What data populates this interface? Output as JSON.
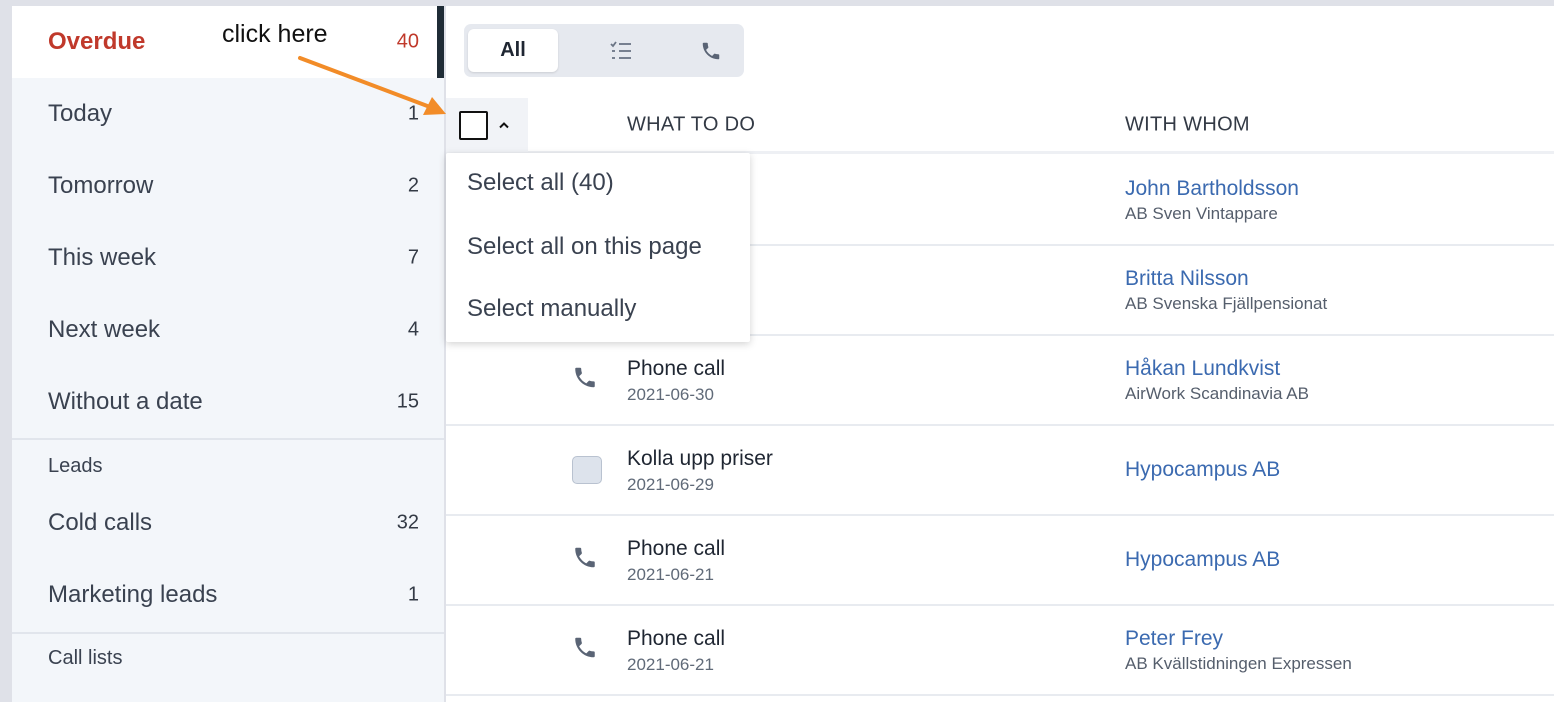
{
  "sidebar": {
    "items": [
      {
        "label": "Overdue",
        "count": "40"
      },
      {
        "label": "Today",
        "count": "1"
      },
      {
        "label": "Tomorrow",
        "count": "2"
      },
      {
        "label": "This week",
        "count": "7"
      },
      {
        "label": "Next week",
        "count": "4"
      },
      {
        "label": "Without a date",
        "count": "15"
      }
    ],
    "leads_heading": "Leads",
    "leads": [
      {
        "label": "Cold calls",
        "count": "32"
      },
      {
        "label": "Marketing leads",
        "count": "1"
      }
    ],
    "call_lists_heading": "Call lists"
  },
  "filter": {
    "all_label": "All",
    "icons": [
      "task-list-icon",
      "phone-icon"
    ]
  },
  "table": {
    "col_what": "WHAT TO DO",
    "col_whom": "WITH WHOM",
    "rows": [
      {
        "type": "hidden",
        "title": "",
        "date": "",
        "who": "John Bartholdsson",
        "company": "AB Sven Vintappare"
      },
      {
        "type": "hidden",
        "title": "",
        "date": "",
        "who": "Britta Nilsson",
        "company": "AB Svenska Fjällpensionat"
      },
      {
        "type": "phone",
        "title": "Phone call",
        "date": "2021-06-30",
        "who": "Håkan Lundkvist",
        "company": "AirWork Scandinavia AB"
      },
      {
        "type": "task",
        "title": "Kolla upp priser",
        "date": "2021-06-29",
        "who": "Hypocampus AB",
        "company": ""
      },
      {
        "type": "phone",
        "title": "Phone call",
        "date": "2021-06-21",
        "who": "Hypocampus AB",
        "company": ""
      },
      {
        "type": "phone",
        "title": "Phone call",
        "date": "2021-06-21",
        "who": "Peter Frey",
        "company": "AB Kvällstidningen Expressen"
      }
    ]
  },
  "dropdown": {
    "items": [
      "Select all (40)",
      "Select all on this page",
      "Select manually"
    ]
  },
  "annotation": {
    "text": "click here",
    "color": "#f28c28"
  },
  "colors": {
    "overdue": "#c0392b",
    "link": "#3b6ab0",
    "active_bar": "#1f2c36"
  }
}
